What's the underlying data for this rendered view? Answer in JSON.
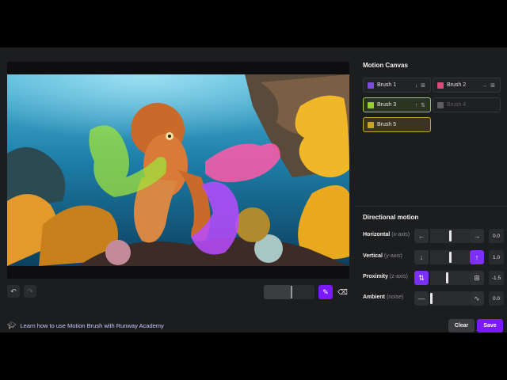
{
  "editor": {
    "undo_icon": "undo-icon",
    "redo_icon": "redo-icon",
    "brush_size_fraction": 0.53,
    "brush_tool_icon": "brush-icon",
    "eraser_icon": "eraser-icon"
  },
  "academy_link": "Learn how to use Motion Brush with Runway Academy",
  "panel": {
    "canvas_title": "Motion Canvas",
    "brushes": [
      {
        "label": "Brush 1",
        "color": "#7b4bd9",
        "tools": "↓ ⊞",
        "state": "normal"
      },
      {
        "label": "Brush 2",
        "color": "#d94b7b",
        "tools": "→ ⊞",
        "state": "normal"
      },
      {
        "label": "Brush 3",
        "color": "#9acd32",
        "tools": "↑ ⇅",
        "state": "active-green"
      },
      {
        "label": "Brush 4",
        "color": "#5e5e62",
        "tools": "",
        "state": "disabled"
      },
      {
        "label": "Brush 5",
        "color": "#c9a227",
        "tools": "",
        "state": "active-gold"
      }
    ],
    "motion_title": "Directional motion",
    "motions": [
      {
        "label": "Horizontal",
        "axis": "(x-axis)",
        "left_icon": "←",
        "right_icon": "→",
        "value": "0.0",
        "knob": 0.5,
        "active": "none"
      },
      {
        "label": "Vertical",
        "axis": "(y-axis)",
        "left_icon": "↓",
        "right_icon": "↑",
        "value": "1.0",
        "knob": 0.52,
        "active": "right"
      },
      {
        "label": "Proximity",
        "axis": "(z-axis)",
        "left_icon": "⇅",
        "right_icon": "⊞",
        "value": "-1.5",
        "knob": 0.42,
        "active": "left"
      },
      {
        "label": "Ambient",
        "axis": "(noise)",
        "left_icon": "—",
        "right_icon": "∿",
        "value": "0.0",
        "knob": 0.0,
        "active": "none"
      }
    ],
    "clear_label": "Clear",
    "save_label": "Save"
  }
}
